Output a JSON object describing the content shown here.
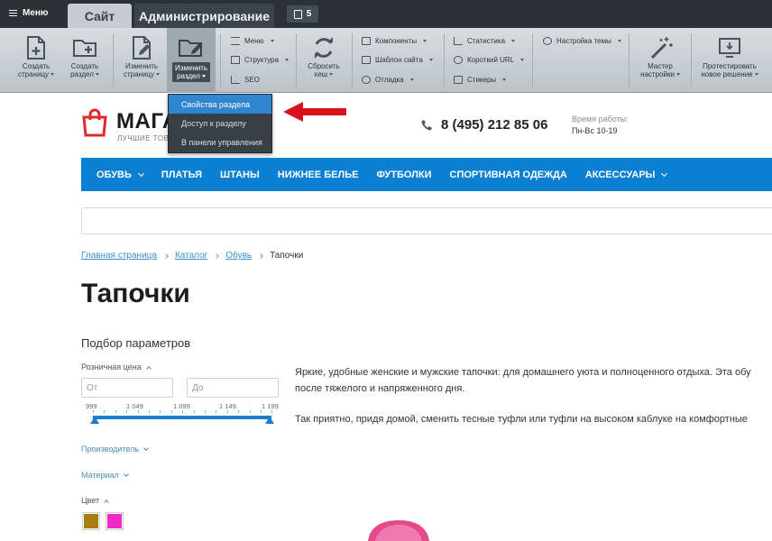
{
  "admin": {
    "menu_label": "Меню",
    "tabs": {
      "site": "Сайт",
      "admin": "Администрирование"
    },
    "notifications": "5",
    "toolbar": {
      "create_page": "Создать\nстраницу",
      "create_section": "Создать\nраздел",
      "edit_page": "Изменить\nстраницу",
      "edit_section": "Изменить\nраздел",
      "menu": "Меню",
      "structure": "Структура",
      "seo": "SEO",
      "reset_cache": "Сбросить\nкеш",
      "components": "Компоненты",
      "site_template": "Шаблон сайта",
      "debug": "Отладка",
      "statistics": "Статистика",
      "short_url": "Короткий URL",
      "stickers": "Стикеры",
      "theme_settings": "Настройка темы",
      "settings_wizard": "Мастер\nнастройки",
      "test_solution": "Протестировать\nновое решение"
    },
    "dropdown": [
      "Свойства раздела",
      "Доступ к разделу",
      "В панели управления"
    ]
  },
  "header": {
    "logo_text": "МАГА",
    "logo_sub": "ЛУЧШИЕ ТОВ",
    "phone": "8 (495) 212 85 06",
    "hours_label": "Время работы:",
    "hours_value": "Пн-Вс 10-19"
  },
  "nav": [
    "ОБУВЬ",
    "ПЛАТЬЯ",
    "ШТАНЫ",
    "НИЖНЕЕ БЕЛЬЕ",
    "ФУТБОЛКИ",
    "СПОРТИВНАЯ ОДЕЖДА",
    "АКСЕССУАРЫ"
  ],
  "breadcrumbs": {
    "home": "Главная страница",
    "catalog": "Каталог",
    "shoes": "Обувь",
    "current": "Тапочки"
  },
  "page_title": "Тапочки",
  "filter": {
    "title": "Подбор параметров",
    "price_label": "Розничная цена",
    "from_placeholder": "От",
    "to_placeholder": "До",
    "ticks": [
      "999",
      "1 049",
      "1 099",
      "1 149",
      "1 199"
    ],
    "price_min": 999,
    "price_max": 1199,
    "range_from": 999,
    "range_to": 1199,
    "manufacturer": "Производитель",
    "material": "Материал",
    "color": "Цвет",
    "colors": [
      "#a87c10",
      "#f229c8"
    ]
  },
  "description": {
    "line1": "Яркие, удобные женские и мужские тапочки: для домашнего уюта и полноценного отдыха. Эта обу",
    "line2": "после тяжелого и напряженного дня.",
    "line3": "Так приятно, придя домой, сменить тесные туфли или туфли на высоком каблуке на комфортные"
  },
  "accent": "#0b80d3"
}
